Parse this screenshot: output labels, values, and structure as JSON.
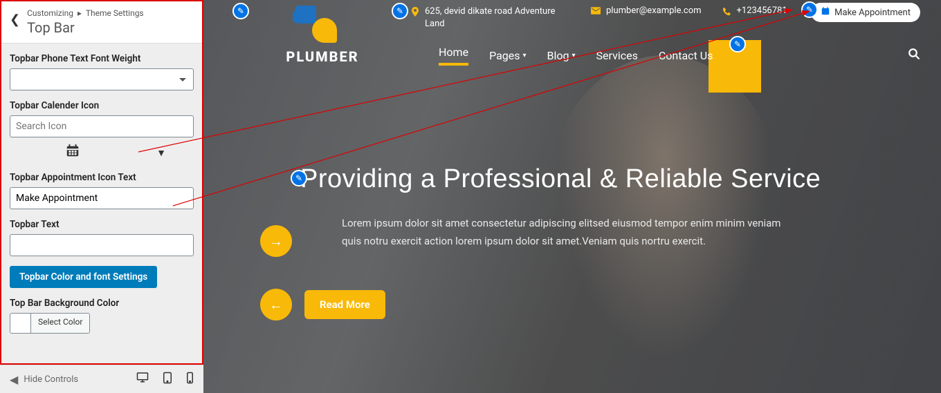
{
  "customizer": {
    "breadcrumb_prefix": "Customizing",
    "breadcrumb_section": "Theme Settings",
    "title": "Top Bar",
    "fields": {
      "phone_weight_label": "Topbar Phone Text Font Weight",
      "calendar_icon_label": "Topbar Calender Icon",
      "calendar_icon_placeholder": "Search Icon",
      "appointment_text_label": "Topbar Appointment Icon Text",
      "appointment_text_value": "Make Appointment",
      "topbar_text_label": "Topbar Text",
      "topbar_text_value": "",
      "color_settings_btn": "Topbar Color and font Settings",
      "bg_color_label": "Top Bar Background Color",
      "select_color": "Select Color"
    },
    "footer": {
      "hide_controls": "Hide Controls"
    }
  },
  "site": {
    "logo_text": "PLUMBER",
    "topbar": {
      "address": "625, devid dikate road Adventure Land",
      "email": "plumber@example.com",
      "phone": "+123456781",
      "appointment_btn": "Make Appointment"
    },
    "nav": {
      "home": "Home",
      "pages": "Pages",
      "blog": "Blog",
      "services": "Services",
      "contact": "Contact Us"
    },
    "hero": {
      "title": "Providing a Professional & Reliable Service",
      "desc": "Lorem ipsum dolor sit amet consectetur adipiscing elitsed eiusmod tempor enim minim veniam quis notru exercit action lorem ipsum dolor sit amet.Veniam quis nortru exercit.",
      "read_more": "Read More"
    }
  }
}
